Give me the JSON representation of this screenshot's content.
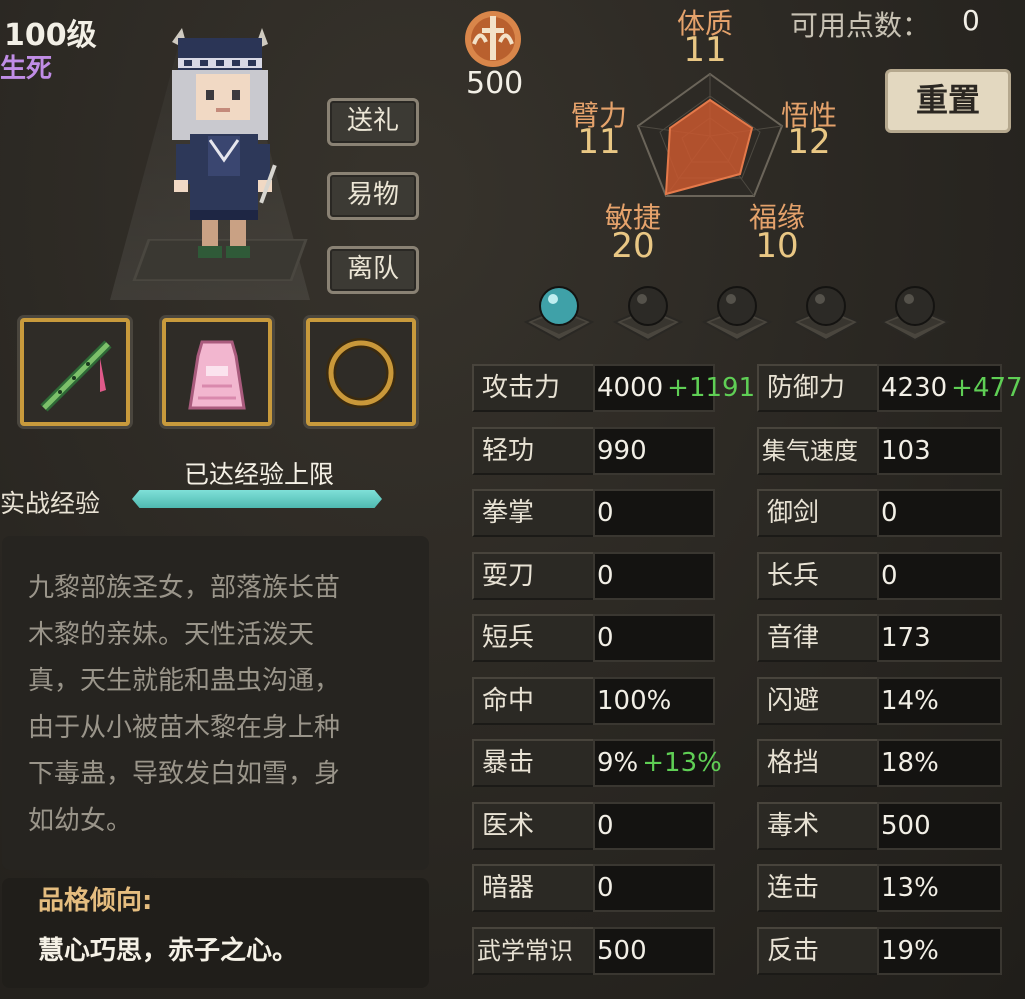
{
  "header": {
    "level": "100级",
    "status": "生死"
  },
  "actions": {
    "gift": "送礼",
    "trade": "易物",
    "leave": "离队"
  },
  "equipment": [
    "flute-icon",
    "pink-dress-icon",
    "ring-icon"
  ],
  "experience": {
    "label": "实战经验",
    "status": "已达经验上限",
    "progress": 1.0
  },
  "description": "九黎部族圣女，部落族长苗\n木黎的亲妹。天性活泼天\n真，天生就能和蛊虫沟通，\n由于从小被苗木黎在身上种\n下毒蛊，导致发白如雪，身\n如幼女。",
  "trait": {
    "title": "品格倾向:",
    "value": "慧心巧思，赤子之心。"
  },
  "points": {
    "icon": "sword-emblem-icon",
    "value": "500",
    "available_label": "可用点数：",
    "available_value": "0",
    "reset_label": "重置"
  },
  "attributes": {
    "constitution": {
      "name": "体质",
      "value": "11"
    },
    "comprehension": {
      "name": "悟性",
      "value": "12"
    },
    "fortune": {
      "name": "福缘",
      "value": "10"
    },
    "agility": {
      "name": "敏捷",
      "value": "20"
    },
    "strength": {
      "name": "臂力",
      "value": "11"
    }
  },
  "orbs": {
    "unlocked": 1,
    "total": 5,
    "active_color": "#3fa1a8",
    "inactive_color": "#2c2a26"
  },
  "stats": {
    "left": [
      {
        "label": "攻击力",
        "value": "4000",
        "bonus": "+1191"
      },
      {
        "label": "轻功",
        "value": "990",
        "bonus": ""
      },
      {
        "label": "拳掌",
        "value": "0",
        "bonus": ""
      },
      {
        "label": "耍刀",
        "value": "0",
        "bonus": ""
      },
      {
        "label": "短兵",
        "value": "0",
        "bonus": ""
      },
      {
        "label": "命中",
        "value": "100%",
        "bonus": ""
      },
      {
        "label": "暴击",
        "value": "9%",
        "bonus": "+13%"
      },
      {
        "label": "医术",
        "value": "0",
        "bonus": ""
      },
      {
        "label": "暗器",
        "value": "0",
        "bonus": ""
      },
      {
        "label": "武学常识",
        "value": "500",
        "bonus": ""
      }
    ],
    "right": [
      {
        "label": "防御力",
        "value": "4230",
        "bonus": "+477"
      },
      {
        "label": "集气速度",
        "value": "103",
        "bonus": ""
      },
      {
        "label": "御剑",
        "value": "0",
        "bonus": ""
      },
      {
        "label": "长兵",
        "value": "0",
        "bonus": ""
      },
      {
        "label": "音律",
        "value": "173",
        "bonus": ""
      },
      {
        "label": "闪避",
        "value": "14%",
        "bonus": ""
      },
      {
        "label": "格挡",
        "value": "18%",
        "bonus": ""
      },
      {
        "label": "毒术",
        "value": "500",
        "bonus": ""
      },
      {
        "label": "连击",
        "value": "13%",
        "bonus": ""
      },
      {
        "label": "反击",
        "value": "19%",
        "bonus": ""
      }
    ]
  },
  "colors": {
    "bonus": "#5fcf55",
    "attr_name": "#e5a26b",
    "attr_value": "#e9c784",
    "slot_border": "#c89a3c"
  }
}
